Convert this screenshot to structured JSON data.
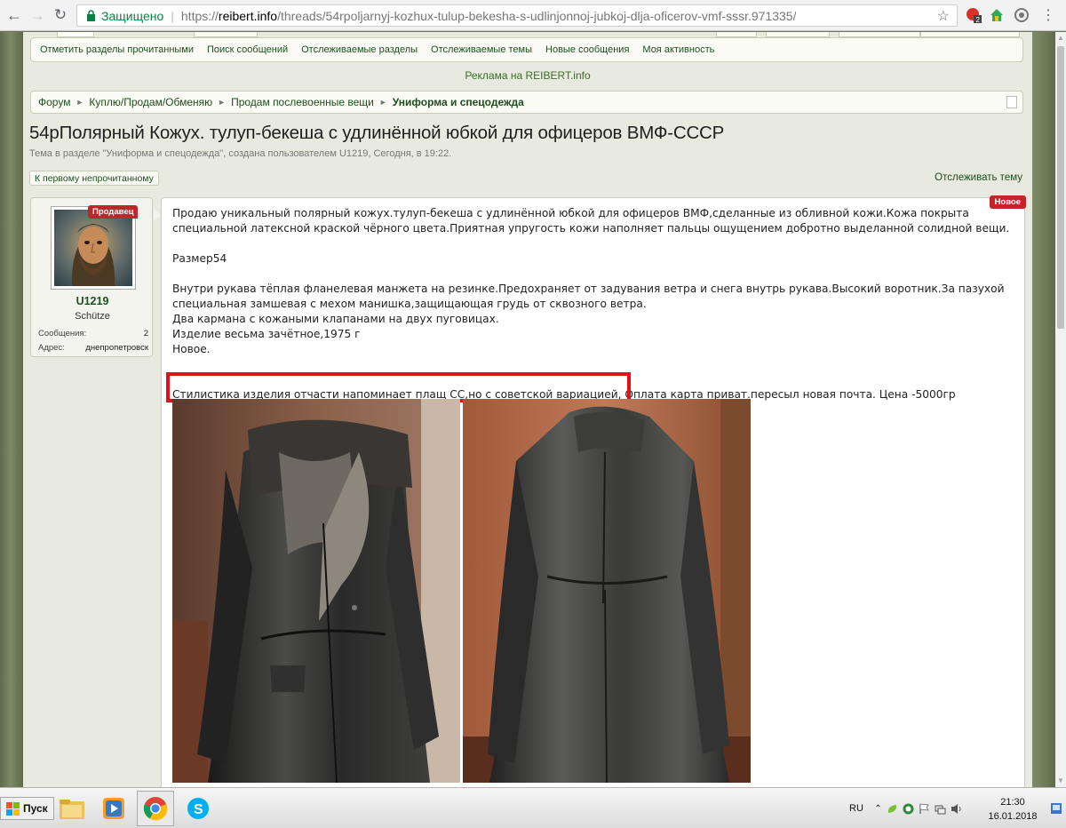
{
  "browser": {
    "secure_label": "Защищено",
    "url_scheme": "https://",
    "url_host": "reibert.info",
    "url_path": "/threads/54rpoljarnyj-kozhux-tulup-bekesha-s-udlinjonnoj-jubkoj-dlja-oficerov-vmf-sssr.971335/",
    "ext_badge": "2"
  },
  "subnav": {
    "items": [
      "Отметить разделы прочитанными",
      "Поиск сообщений",
      "Отслеживаемые разделы",
      "Отслеживаемые темы",
      "Новые сообщения",
      "Моя активность"
    ]
  },
  "ad": "Реклама на REIBERT.info",
  "breadcrumb": {
    "items": [
      "Форум",
      "Куплю/Продам/Обменяю",
      "Продам послевоенные вещи"
    ],
    "current": "Униформа и спецодежда"
  },
  "thread": {
    "title": "54рПолярный Кожух. тулуп-бекеша с удлинённой юбкой для офицеров ВМФ-СССР",
    "description": "Тема в разделе \"Униформа и спецодежда\", создана пользователем U1219, Сегодня, в 19:22.",
    "first_unread": "К первому непрочитанному",
    "watch": "Отслеживать тему"
  },
  "user": {
    "badge": "Продавец",
    "name": "U1219",
    "title": "Schütze",
    "messages_label": "Сообщения:",
    "messages_value": "2",
    "address_label": "Адрес:",
    "address_value": "днепропетровск"
  },
  "post": {
    "new_badge": "Новое",
    "p1_l1": "Продаю уникальный полярный кожух.тулуп-бекеша с удлинённой юбкой для офицеров ВМФ,сделанные из обливной кожи.Кожа покрыта",
    "p1_l2": "специальной латексной краской чёрного цвета.Приятная упругость кожи наполняет пальцы ощущением добротно выделанной солидной вещи.",
    "size": "Размер54",
    "p3_l1": "Внутри рукава тёплая фланелевая манжета на резинке.Предохраняет от задувания ветра и снега внутрь рукава.Высокий воротник.За пазухой",
    "p3_l2": "специальная замшевая с мехом манишка,защищающая грудь от сквозного ветра.",
    "p3_l3": "Два кармана с кожаными клапанами на двух пуговицах.",
    "p3_l4": "Изделие весьма зачётное,1975 г",
    "p3_l5": "Новое.",
    "line_last": "Стилистика изделия отчасти напоминает плащ СС,но с советской вариацией, Оплата карта приват.пересыл новая почта. Цена -5000гр"
  },
  "taskbar": {
    "start": "Пуск",
    "lang": "RU",
    "time": "21:30",
    "date": "16.01.2018"
  },
  "colors": {
    "link_green": "#1e4d1e",
    "badge_red": "#c0252b",
    "highlight_red": "#e3101b",
    "secure_green": "#0b8043"
  }
}
